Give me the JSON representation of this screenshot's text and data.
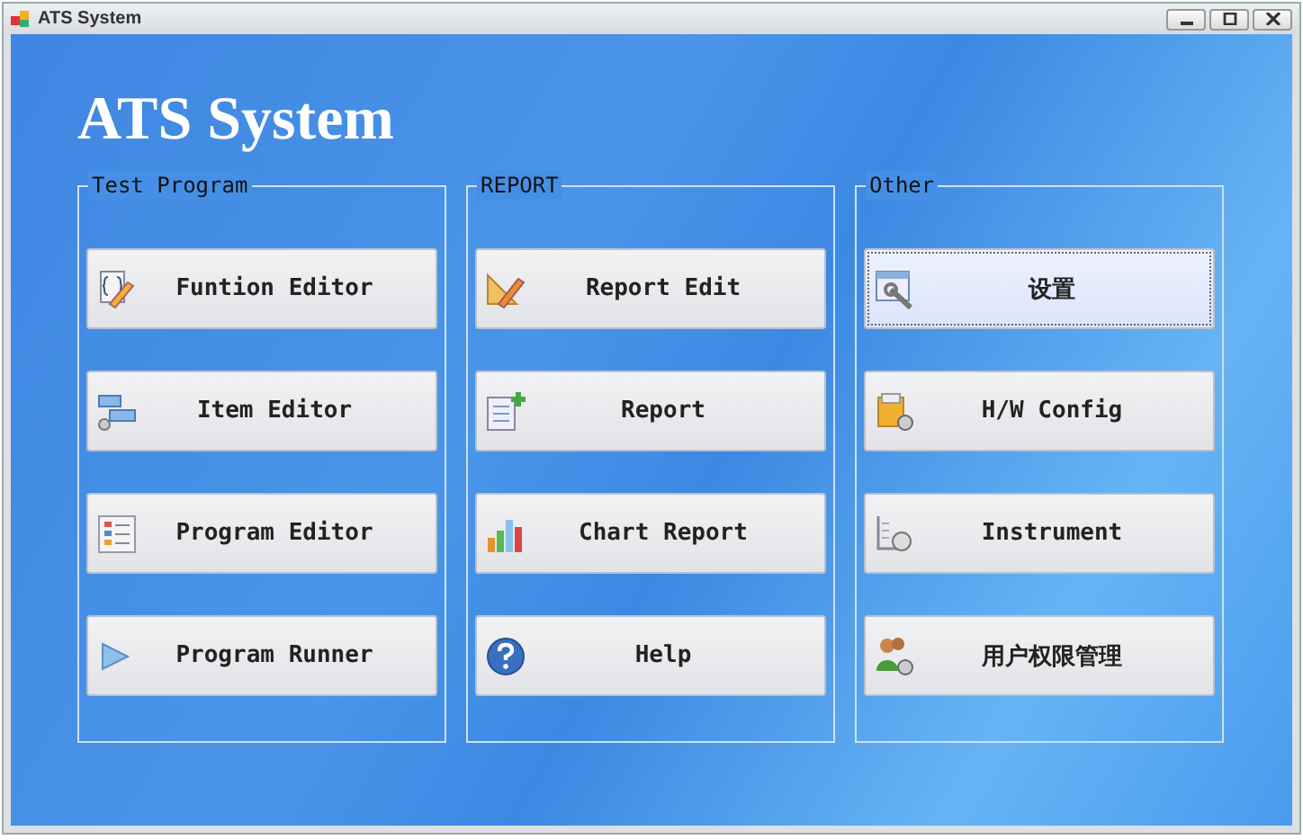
{
  "window": {
    "title": "ATS System"
  },
  "heading": "ATS System",
  "groups": [
    {
      "title": "Test Program",
      "buttons": [
        {
          "label": "Funtion Editor",
          "selected": false
        },
        {
          "label": "Item Editor",
          "selected": false
        },
        {
          "label": "Program Editor",
          "selected": false
        },
        {
          "label": "Program Runner",
          "selected": false
        }
      ]
    },
    {
      "title": "REPORT",
      "buttons": [
        {
          "label": "Report Edit",
          "selected": false
        },
        {
          "label": "Report",
          "selected": false
        },
        {
          "label": "Chart Report",
          "selected": false
        },
        {
          "label": "Help",
          "selected": false
        }
      ]
    },
    {
      "title": "Other",
      "buttons": [
        {
          "label": "设置",
          "selected": true
        },
        {
          "label": "H/W Config",
          "selected": false
        },
        {
          "label": "Instrument",
          "selected": false
        },
        {
          "label": "用户权限管理",
          "selected": false
        }
      ]
    }
  ]
}
